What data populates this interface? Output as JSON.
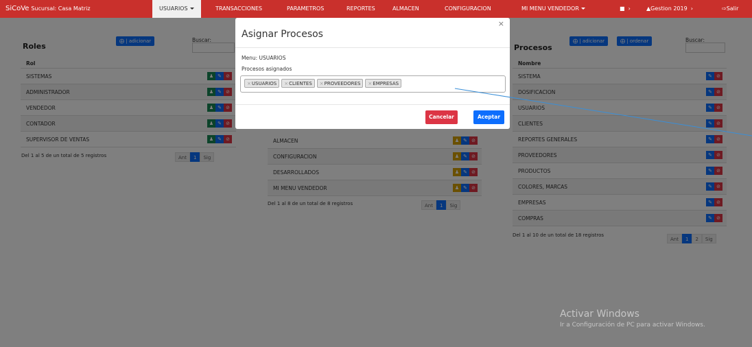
{
  "navbar": {
    "brand": "SiCoVe",
    "branch": "Sucursal: Casa Matriz",
    "items": [
      {
        "label": "USUARIOS"
      },
      {
        "label": "TRANSACCIONES"
      },
      {
        "label": "PARAMETROS"
      },
      {
        "label": "REPORTES"
      },
      {
        "label": "ALMACEN"
      },
      {
        "label": "CONFIGURACION"
      },
      {
        "label": "MI MENU VENDEDOR"
      }
    ],
    "gestion": "Gestion 2019",
    "logout": "Salir"
  },
  "roles": {
    "title": "Roles",
    "add_label": "| adicionar",
    "search_label": "Buscar:",
    "column": "Rol",
    "rows": [
      "SISTEMAS",
      "ADMINISTRADOR",
      "VENDEDOR",
      "CONTADOR",
      "SUPERVISOR DE VENTAS"
    ],
    "footer": "Del 1 al 5 de un total de 5 registros",
    "pager": {
      "prev": "Ant",
      "page": "1",
      "next": "Sig"
    }
  },
  "menus": {
    "rows": [
      "ALMACEN",
      "CONFIGURACION",
      "DESARROLLADOS",
      "MI MENU VENDEDOR"
    ],
    "footer": "Del 1 al 8 de un total de 8 registros",
    "pager": {
      "prev": "Ant",
      "page": "1",
      "next": "Sig"
    }
  },
  "procesos": {
    "title": "Procesos",
    "add_label": "| adicionar",
    "order_label": "| ordenar",
    "search_label": "Buscar:",
    "column": "Nombre",
    "rows": [
      "SISTEMA",
      "DOSIFICACION",
      "USUARIOS",
      "CLIENTES",
      "REPORTES GENERALES",
      "PROVEEDORES",
      "PRODUCTOS",
      "COLORES, MARCAS",
      "EMPRESAS",
      "COMPRAS"
    ],
    "footer": "Del 1 al 10 de un total de 18 registros",
    "pager": {
      "prev": "Ant",
      "page1": "1",
      "page2": "2",
      "next": "Sig"
    }
  },
  "modal": {
    "title": "Asignar Procesos",
    "close": "×",
    "menu_text": "Menu: USUARIOS",
    "assigned_label": "Procesos asignados",
    "tags": [
      "USUARIOS",
      "CLIENTES",
      "PROVEEDORES",
      "EMPRESAS"
    ],
    "tag_remove": "×",
    "cancel": "Cancelar",
    "accept": "Aceptar"
  },
  "watermark": {
    "line1": "Activar Windows",
    "line2": "Ir a Configuración de PC para activar Windows."
  }
}
